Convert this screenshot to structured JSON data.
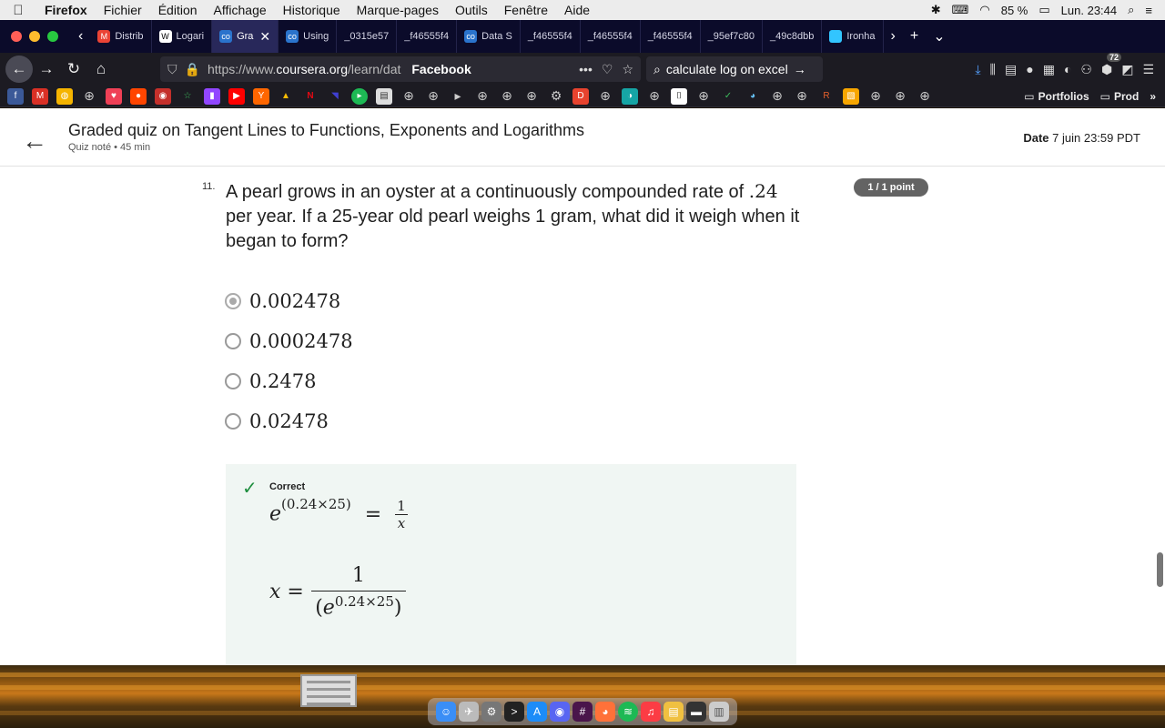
{
  "menubar": {
    "app": "Firefox",
    "items": [
      "Fichier",
      "Édition",
      "Affichage",
      "Historique",
      "Marque-pages",
      "Outils",
      "Fenêtre",
      "Aide"
    ],
    "battery": "85 %",
    "clock": "Lun. 23:44"
  },
  "tabs": [
    {
      "label": "Distrib",
      "color": "#ea4335",
      "glyph": "M",
      "active": false
    },
    {
      "label": "Logari",
      "color": "#ffffff",
      "glyph": "W",
      "active": false
    },
    {
      "label": "Gra",
      "color": "#2a73cc",
      "glyph": "co",
      "active": true
    },
    {
      "label": "Using",
      "color": "#2a73cc",
      "glyph": "co",
      "active": false
    },
    {
      "label": "_0315e57",
      "color": "",
      "glyph": "",
      "active": false
    },
    {
      "label": "_f46555f4",
      "color": "",
      "glyph": "",
      "active": false
    },
    {
      "label": "Data S",
      "color": "#2a73cc",
      "glyph": "co",
      "active": false
    },
    {
      "label": "_f46555f4",
      "color": "",
      "glyph": "",
      "active": false
    },
    {
      "label": "_f46555f4",
      "color": "",
      "glyph": "",
      "active": false
    },
    {
      "label": "_f46555f4",
      "color": "",
      "glyph": "",
      "active": false
    },
    {
      "label": "_95ef7c80",
      "color": "",
      "glyph": "",
      "active": false
    },
    {
      "label": "_49c8dbb",
      "color": "",
      "glyph": "",
      "active": false
    },
    {
      "label": "Ironha",
      "color": "#32c5ff",
      "glyph": "",
      "active": false
    }
  ],
  "navbar": {
    "url_prefix": "https://www.",
    "url_host": "coursera.org",
    "url_path": "/learn/dat",
    "facebook": "Facebook",
    "search_value": "calculate log on excel",
    "badge": "72"
  },
  "bookmarks": {
    "folders": [
      "Portfolios",
      "Prod"
    ]
  },
  "quiz": {
    "title": "Graded quiz on Tangent Lines to Functions, Exponents and Logarithms",
    "subtitle": "Quiz noté • 45  min",
    "date_label": "Date",
    "date_value": "7 juin 23:59 PDT",
    "question_number": "11.",
    "question_pre": "A pearl grows in an oyster at a continuously compounded rate of",
    "question_rate": ".24",
    "question_post": "per year. If a 25-year old pearl weighs 1 gram, what did it weigh when it began to form?",
    "points": "1 / 1 point",
    "options": [
      "0.002478",
      "0.0002478",
      "0.2478",
      "0.02478"
    ],
    "selected_index": 0,
    "feedback_label": "Correct",
    "eq1_lhs_base": "e",
    "eq1_lhs_exp": "(0.24×25)",
    "eq1_rhs_num": "1",
    "eq1_rhs_den": "x",
    "eq2_lhs": "x =",
    "eq2_num": "1",
    "eq2_den_open": "(",
    "eq2_den_base": "e",
    "eq2_den_exp": "0.24×25",
    "eq2_den_close": ")"
  },
  "colors": {
    "correct_green": "#1e8e3e",
    "feedback_bg": "#f0f6f3",
    "badge_grey": "#636363"
  }
}
